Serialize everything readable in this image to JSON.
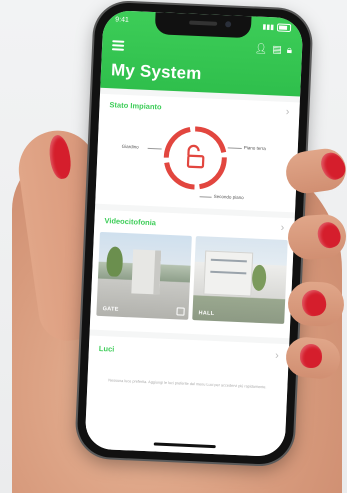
{
  "app": {
    "title": "My System",
    "status_time": "9:41",
    "header_icons": [
      "person-icon",
      "list-icon",
      "lock-icon"
    ]
  },
  "alarm_status": {
    "section_label": "Stato Impianto",
    "ring_labels": {
      "left": "Giardino",
      "right": "Piano terra",
      "bottom": "Secondo piano"
    }
  },
  "video_intercom": {
    "section_label": "Videocitofonia",
    "cameras": [
      {
        "label": "GATE"
      },
      {
        "label": "HALL"
      }
    ]
  },
  "lights": {
    "section_label": "Luci",
    "footer_note": "Nessuna luce preferita. Aggiungi le luci preferite dal menu Luci per accedervi più rapidamente."
  },
  "colors": {
    "accent": "#3dcd58",
    "alarm_ring": "#e2463f",
    "nail_polish": "#d51e2c"
  }
}
